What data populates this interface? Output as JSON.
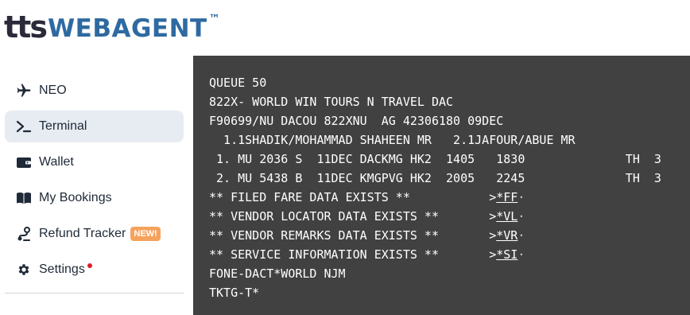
{
  "brand": {
    "tts": "tts",
    "webagent": "WEBAGENT",
    "tm": "™"
  },
  "sidebar": {
    "items": [
      {
        "label": "NEO"
      },
      {
        "label": "Terminal"
      },
      {
        "label": "Wallet"
      },
      {
        "label": "My Bookings"
      },
      {
        "label": "Refund Tracker",
        "badge": "NEW!"
      },
      {
        "label": "Settings"
      }
    ]
  },
  "terminal": {
    "lines": [
      "QUEUE 50",
      "822X- WORLD WIN TOURS N TRAVEL DAC",
      "F90699/NU DACOU 822XNU  AG 42306180 09DEC",
      "  1.1SHADIK/MOHAMMAD SHAHEEN MR   2.1JAFOUR/ABUE MR",
      " 1. MU 2036 S  11DEC DACKMG HK2  1405   1830              TH  3",
      " 2. MU 5438 B  11DEC KMGPVG HK2  2005   2245              TH  3",
      "** FILED FARE DATA EXISTS **           ",
      "** VENDOR LOCATOR DATA EXISTS **       ",
      "** VENDOR REMARKS DATA EXISTS **       ",
      "** SERVICE INFORMATION EXISTS **       ",
      "FONE-DACT*WORLD NJM",
      "TKTG-T*"
    ],
    "links": [
      {
        "prefix": ">",
        "cmd": "*FF",
        "dot": "·"
      },
      {
        "prefix": ">",
        "cmd": "*VL",
        "dot": "·"
      },
      {
        "prefix": ">",
        "cmd": "*VR",
        "dot": "·"
      },
      {
        "prefix": ">",
        "cmd": "*SI",
        "dot": "·"
      }
    ]
  },
  "colors": {
    "brand_dark": "#2a2a3a",
    "brand_blue": "#2e6aa1",
    "terminal_bg": "#414141",
    "active_nav_bg": "#e6ecf2",
    "badge_bg": "#f5a25d",
    "notify_dot": "#e11d2a"
  },
  "icons": {
    "neo": "airplane-icon",
    "terminal": "terminal-prompt-icon",
    "wallet": "wallet-icon",
    "bookings": "open-book-icon",
    "refund": "route-icon",
    "settings": "gear-icon"
  }
}
